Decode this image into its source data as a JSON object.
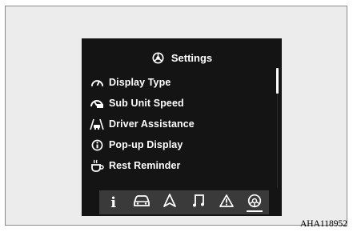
{
  "screen": {
    "title": "Settings",
    "menu": [
      {
        "label": "Display Type",
        "icon": "gauge-icon"
      },
      {
        "label": "Sub Unit Speed",
        "icon": "speedometer-icon"
      },
      {
        "label": "Driver Assistance",
        "icon": "driver-assist-icon"
      },
      {
        "label": "Pop-up Display",
        "icon": "info-circle-icon"
      },
      {
        "label": "Rest Reminder",
        "icon": "coffee-cup-icon"
      }
    ],
    "tabs": [
      {
        "icon": "info-icon",
        "glyph": "i"
      },
      {
        "icon": "car-icon"
      },
      {
        "icon": "navigation-icon"
      },
      {
        "icon": "music-icon"
      },
      {
        "icon": "warning-icon"
      },
      {
        "icon": "settings-icon",
        "active": true
      }
    ]
  },
  "caption": "AHA118952",
  "colors": {
    "screen_bg": "#141414",
    "tabbar_bg": "#3a3a3a",
    "text": "#ffffff"
  }
}
